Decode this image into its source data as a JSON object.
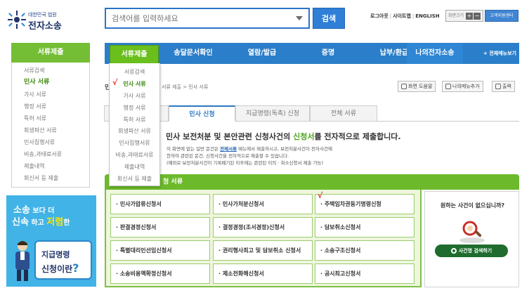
{
  "header": {
    "logo_sub": "대한민국 법원",
    "logo_main": "전자소송",
    "search_placeholder": "검색어를 입력하세요",
    "search_button": "검색",
    "util": {
      "logout": "로그아웃",
      "sitemap": "사이트맵",
      "english": "ENGLISH",
      "sep": "|"
    },
    "fontsize_label": "화면크기",
    "fontsize_plus": "+",
    "fontsize_minus": "−",
    "helpdesk": "고객지원센터"
  },
  "nav": {
    "active": "서류제출",
    "items": [
      "송달문서확인",
      "열람/발급",
      "증명",
      "납부/환급",
      "나의전자소송"
    ],
    "all_menu": "+ 전체메뉴보기"
  },
  "sidebar": {
    "title": "서류제출",
    "items": [
      "서류검색",
      "민사 서류",
      "가사 서류",
      "행정 서류",
      "특허 서류",
      "회생파산 서류",
      "민사집행서류",
      "비송,과태료서류",
      "제출내역",
      "회신서 등 제출"
    ],
    "active_index": 1
  },
  "dropdown": {
    "items": [
      "서류검색",
      "민사 서류",
      "가사 서류",
      "행정 서류",
      "특허 서류",
      "회생파산 서류",
      "민사집행서류",
      "비송,과태료서류",
      "제출내역",
      "회신서 등 제출"
    ],
    "active_index": 1,
    "check_mark": "√"
  },
  "banner": {
    "line1_a": "소송",
    "line1_b": "보다 더",
    "line2_a": "신속",
    "line2_b": "하고",
    "line2_c": "저렴",
    "line2_d": "한",
    "bubble1": "지급명령",
    "bubble2": "신청이란",
    "bubble_q": "?"
  },
  "breadcrumb": {
    "mark": "민",
    "path": "서류 제출 > 민사 서류"
  },
  "tools": {
    "help": "화면 도움말",
    "add_my_menu": "나의메뉴추가",
    "print": "출력"
  },
  "tabs": [
    "민사 신청",
    "지급명령(독촉) 신청",
    "전체 서류"
  ],
  "description": {
    "title_a": "민사 보전처분 및 본안관련 신청사건의 ",
    "title_b": "신청서",
    "title_c": "를 전자적으로 제출합니다.",
    "body1_a": "이 화면에 없는 일반 문건은 ",
    "body1_link": "전체서류",
    "body1_b": " 메뉴에서 제출하시고, 보전처분사건이 전자사건에",
    "body2": "한하여 관련된 문건, 신청사건을 전자적으로 제출할 수 있습니다.",
    "body3": "(예외로 보전처분사건이 기록폐기된 이후에는 관련된 이의 · 취소신청서 제출 가능)"
  },
  "section": {
    "title_tail": "청 서류",
    "cells": [
      [
        "· 민사가압류신청서",
        "· 민사가처분신청서",
        "· 주택임차권등기명령신청"
      ],
      [
        "· 판결경정신청서",
        "· 결정경정(조서경정)신청서",
        "· 담보취소신청서"
      ],
      [
        "· 특별대리인선임신청서",
        "· 권리행사최고 및 담보취소 신청서",
        "· 소송구조신청서"
      ],
      [
        "· 소송비용액확정신청서",
        "· 제소전화해신청서",
        "· 공시최고신청서"
      ]
    ],
    "check_mark": "√"
  },
  "find_panel": {
    "question": "원하는 사건이 없으십니까?",
    "button": "사건명 검색하기"
  },
  "colors": {
    "nav_blue": "#2b7ec9",
    "accent_green": "#6cba2b",
    "check_red": "#e8231d"
  }
}
